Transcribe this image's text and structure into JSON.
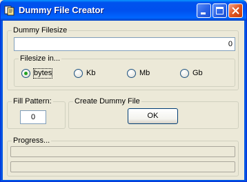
{
  "window": {
    "title": "Dummy File Creator"
  },
  "filesize": {
    "label": "Dummy Filesize",
    "value": "0"
  },
  "unit": {
    "label": "Filesize in...",
    "options": [
      "bytes",
      "Kb",
      "Mb",
      "Gb"
    ],
    "selected": "bytes"
  },
  "fill": {
    "label": "Fill Pattern:",
    "value": "0"
  },
  "create": {
    "label": "Create Dummy File",
    "button": "OK"
  },
  "progress": {
    "label": "Progress...",
    "bar1": 0,
    "bar2": 0
  },
  "colors": {
    "titlebar": "#0054e3",
    "face": "#ece9d8",
    "radio_dot": "#21a121"
  }
}
